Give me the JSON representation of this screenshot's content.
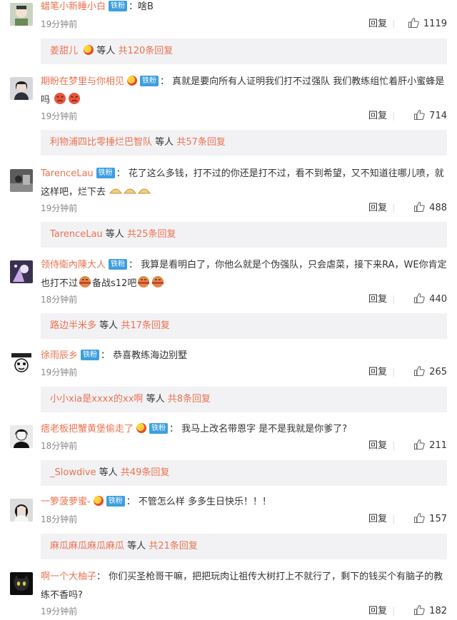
{
  "badge_label": "铁粉",
  "reply_label": "回复",
  "etc_label": "等人",
  "comments": [
    {
      "user": "蜡笔小新睡小白",
      "text": "啥B",
      "time": "19分钟前",
      "likes": "1119",
      "reply_who": "姜甜儿",
      "reply_total": "共120条回复"
    },
    {
      "user": "期盼在梦里与你相见",
      "text": "真就是要向所有人证明我们打不过强队 我们教练组忙着肝小蜜蜂是吗",
      "time": "19分钟前",
      "likes": "714",
      "reply_who": "利物浦四比零捶烂巴智队",
      "reply_total": "共57条回复"
    },
    {
      "user": "TarenceLau",
      "text": "花了这么多钱，打不过的你还是打不过，看不到希望，又不知道往哪儿喷，就这样吧，烂下去",
      "time": "19分钟前",
      "likes": "488",
      "reply_who": "TarenceLau",
      "reply_total": "共25条回复"
    },
    {
      "user": "领侍衛內陳大人",
      "text": "我算是看明白了，你他么就是个伪强队，只会虐菜，接下来RA，WE你肯定也打不过",
      "text2": "备战s12吧",
      "time": "18分钟前",
      "likes": "440",
      "reply_who": "路边半米多",
      "reply_total": "共17条回复"
    },
    {
      "user": "徐雨辰乡",
      "text": "恭喜教练海边别墅",
      "time": "19分钟前",
      "likes": "265",
      "reply_who": "小小xia是xxxx的xx啊",
      "reply_total": "共8条回复"
    },
    {
      "user": "痞老板把蟹黄堡偷走了",
      "text": "我马上改名带恩字 是不是我就是你爹了?",
      "time": "18分钟前",
      "likes": "211",
      "reply_who": "_Slowdive",
      "reply_total": "共49条回复"
    },
    {
      "user": "一箩菠萝蜜-",
      "text": "不管怎么样 多多生日快乐！！！",
      "time": "18分钟前",
      "likes": "157",
      "reply_who": "麻瓜麻瓜麻瓜麻瓜",
      "reply_total": "共21条回复"
    },
    {
      "user": "啊一个大柚子",
      "text": "你们买圣枪哥干嘛，把把玩肉让祖传大树打上不就行了，剩下的钱买个有脑子的教练不香吗?",
      "time": "19分钟前",
      "likes": "182"
    }
  ]
}
